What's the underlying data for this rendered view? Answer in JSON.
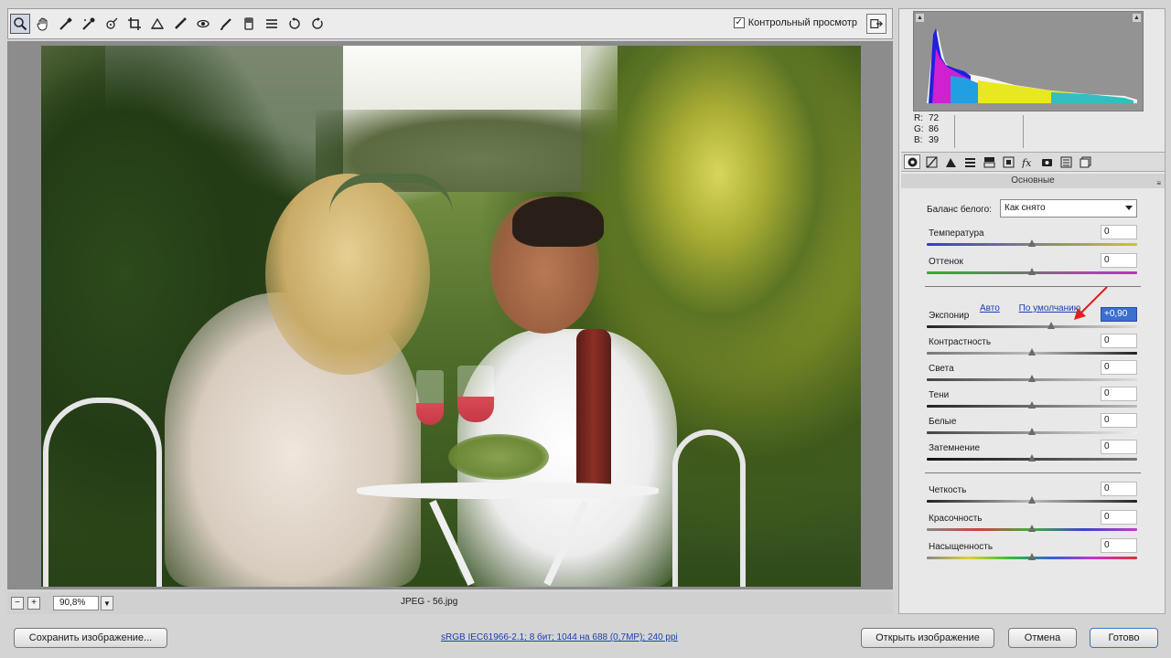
{
  "toolbar": {
    "tools": [
      {
        "name": "zoom-tool-icon"
      },
      {
        "name": "hand-tool-icon"
      },
      {
        "name": "white-balance-tool-icon"
      },
      {
        "name": "color-sampler-tool-icon"
      },
      {
        "name": "targeted-adjustment-tool-icon"
      },
      {
        "name": "crop-tool-icon"
      },
      {
        "name": "straighten-tool-icon"
      },
      {
        "name": "spot-removal-tool-icon"
      },
      {
        "name": "red-eye-tool-icon"
      },
      {
        "name": "adjustment-brush-icon"
      },
      {
        "name": "graduated-filter-icon"
      },
      {
        "name": "preferences-icon"
      },
      {
        "name": "rotate-left-icon"
      },
      {
        "name": "rotate-right-icon"
      }
    ],
    "preview_label": "Контрольный просмотр",
    "preview_checked": true
  },
  "status_bar": {
    "zoom_value": "90,8%",
    "file_label": "JPEG  -  56.jpg"
  },
  "histogram": {
    "r_label": "R:",
    "r_value": "72",
    "g_label": "G:",
    "g_value": "86",
    "b_label": "B:",
    "b_value": "39"
  },
  "panel": {
    "title": "Основные",
    "tabs": [
      "basic-tab-icon",
      "tone-curve-tab-icon",
      "detail-tab-icon",
      "hsl-tab-icon",
      "split-toning-tab-icon",
      "lens-corrections-tab-icon",
      "effects-tab-icon",
      "camera-calibration-tab-icon",
      "presets-tab-icon",
      "snapshots-tab-icon"
    ],
    "white_balance_label": "Баланс белого:",
    "white_balance_value": "Как снято",
    "auto_link": "Авто",
    "default_link": "По умолчанию",
    "sliders": {
      "temperature": {
        "label": "Температура",
        "value": "0"
      },
      "tint": {
        "label": "Оттенок",
        "value": "0"
      },
      "exposure": {
        "label": "Экспонир",
        "value": "+0,90"
      },
      "contrast": {
        "label": "Контрастность",
        "value": "0"
      },
      "highlights": {
        "label": "Света",
        "value": "0"
      },
      "shadows": {
        "label": "Тени",
        "value": "0"
      },
      "whites": {
        "label": "Белые",
        "value": "0"
      },
      "blacks": {
        "label": "Затемнение",
        "value": "0"
      },
      "clarity": {
        "label": "Четкость",
        "value": "0"
      },
      "vibrance": {
        "label": "Красочность",
        "value": "0"
      },
      "saturation": {
        "label": "Насыщенность",
        "value": "0"
      }
    }
  },
  "footer": {
    "save_label": "Сохранить изображение...",
    "info_link": "sRGB IEC61966-2.1; 8 бит; 1044 на 688 (0,7МР); 240 ppi",
    "open_label": "Открыть изображение",
    "cancel_label": "Отмена",
    "done_label": "Готово"
  },
  "colors": {
    "accent": "#3b6fd0",
    "link": "#1a3fb0",
    "annotation_arrow": "#e02020"
  }
}
